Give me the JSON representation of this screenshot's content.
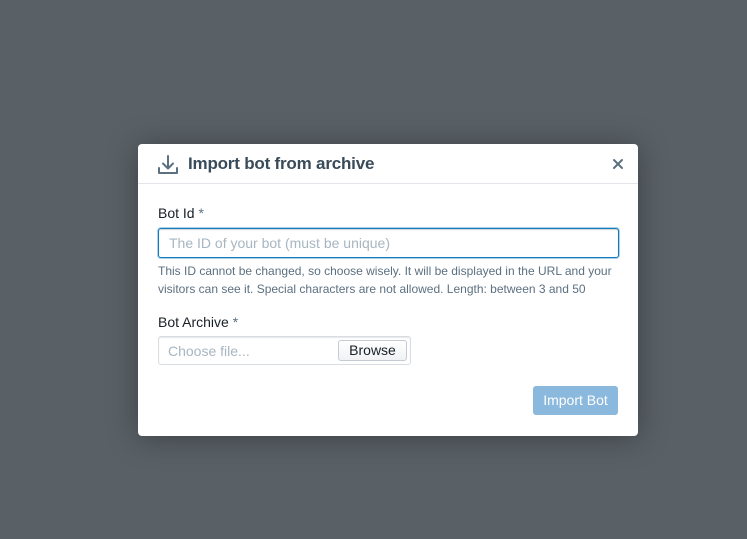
{
  "dialog": {
    "title": "Import bot from archive",
    "header_icon": "download-icon",
    "close_icon": "close-icon"
  },
  "bot_id_field": {
    "label": "Bot Id",
    "required_marker": "*",
    "value": "",
    "placeholder": "The ID of your bot (must be unique)",
    "helper_text": "This ID cannot be changed, so choose wisely. It will be displayed in the URL and your visitors can see it. Special characters are not allowed. Length: between 3 and 50"
  },
  "bot_archive_field": {
    "label": "Bot Archive",
    "required_marker": "*",
    "placeholder": "Choose file...",
    "browse_label": "Browse"
  },
  "actions": {
    "import_label": "Import Bot",
    "import_enabled": false
  },
  "colors": {
    "backdrop": "#5a6166",
    "title": "#394b59",
    "focus_border": "#137cbd",
    "disabled_primary": "#8bb8dd"
  }
}
